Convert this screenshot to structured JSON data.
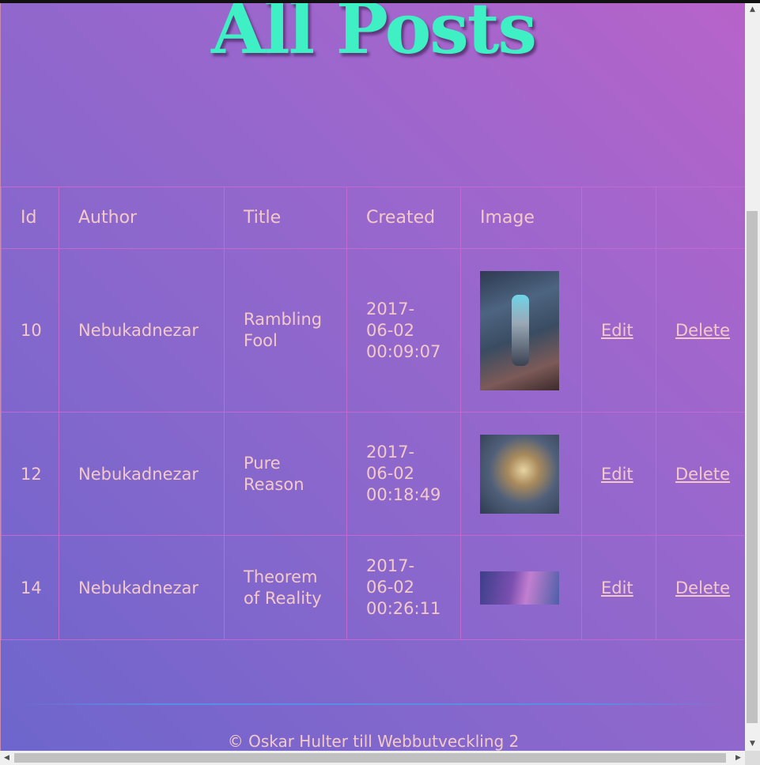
{
  "page": {
    "title": "All Posts"
  },
  "table": {
    "headers": [
      "Id",
      "Author",
      "Title",
      "Created",
      "Image",
      "",
      ""
    ],
    "rows": [
      {
        "id": "10",
        "author": "Nebukadnezar",
        "title_line1": "Rambling",
        "title_line2": "Fool",
        "created_line1": "2017-",
        "created_line2": "06-02",
        "created_line3": "00:09:07",
        "image_alt": "post-image",
        "edit": "Edit",
        "delete": "Delete"
      },
      {
        "id": "12",
        "author": "Nebukadnezar",
        "title_line1": "Pure",
        "title_line2": "Reason",
        "created_line1": "2017-",
        "created_line2": "06-02",
        "created_line3": "00:18:49",
        "image_alt": "post-image",
        "edit": "Edit",
        "delete": "Delete"
      },
      {
        "id": "14",
        "author": "Nebukadnezar",
        "title_line1": "Theorem",
        "title_line2": "of Reality",
        "created_line1": "2017-",
        "created_line2": "06-02",
        "created_line3": "00:26:11",
        "image_alt": "post-image",
        "edit": "Edit",
        "delete": "Delete"
      }
    ]
  },
  "footer": {
    "text": "© Oskar Hulter till Webbutveckling 2"
  },
  "scrollbars": {
    "up": "▲",
    "down": "▼",
    "left": "◀",
    "right": "▶"
  },
  "colors": {
    "title": "#3ff0c4",
    "text": "#f3c9c8",
    "border": "#c06ad0",
    "bg_start": "#b763c9",
    "bg_end": "#6d66cc"
  }
}
